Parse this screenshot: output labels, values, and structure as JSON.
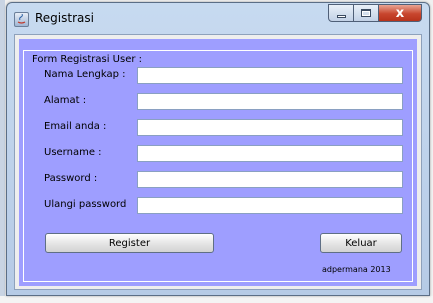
{
  "window": {
    "title": "Registrasi",
    "controls": {
      "close_glyph": "x"
    }
  },
  "form": {
    "legend": "Form Registrasi User :",
    "fields": [
      {
        "label": "Nama Lengkap :",
        "value": ""
      },
      {
        "label": "Alamat :",
        "value": ""
      },
      {
        "label": "Email anda :",
        "value": ""
      },
      {
        "label": "Username :",
        "value": ""
      },
      {
        "label": "Password :",
        "value": ""
      },
      {
        "label": "Ulangi password",
        "value": ""
      }
    ],
    "register_label": "Register",
    "keluar_label": "Keluar",
    "credit": "adpermana 2013"
  },
  "colors": {
    "panel": "#9e9eff",
    "title_bar": "#c7daf0",
    "close_button": "#c8462e"
  },
  "icons": [
    "java-app-icon",
    "minimize-icon",
    "maximize-icon",
    "close-icon"
  ]
}
